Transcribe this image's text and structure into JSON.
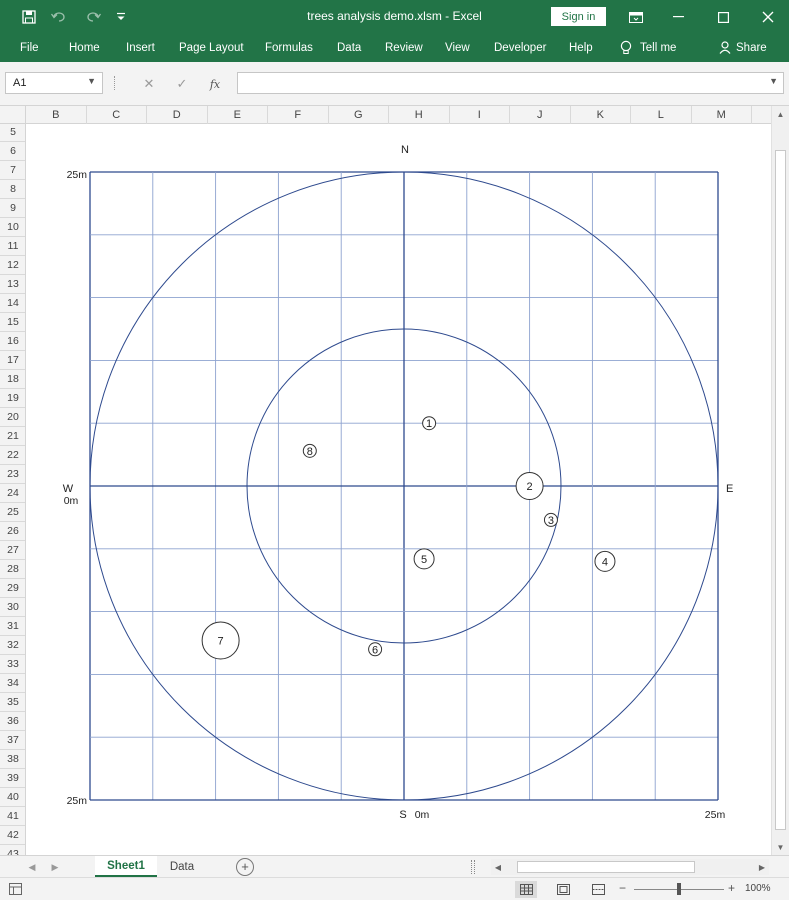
{
  "title_bar": {
    "title": "trees analysis demo.xlsm  -  Excel",
    "sign_in_label": "Sign in",
    "save_icon": "save-icon",
    "undo_icon": "undo-icon",
    "redo_icon": "redo-icon",
    "customize_icon": "customize-quick-access-icon",
    "window_controls": [
      "ribbon-display-options-icon",
      "minimize-icon",
      "maximize-icon",
      "close-icon"
    ]
  },
  "ribbon": {
    "tabs": [
      {
        "label": "File"
      },
      {
        "label": "Home"
      },
      {
        "label": "Insert"
      },
      {
        "label": "Page Layout"
      },
      {
        "label": "Formulas"
      },
      {
        "label": "Data"
      },
      {
        "label": "Review"
      },
      {
        "label": "View"
      },
      {
        "label": "Developer"
      },
      {
        "label": "Help"
      }
    ],
    "tell_me": "Tell me",
    "share": "Share"
  },
  "formula_bar": {
    "name_box": "A1",
    "formula": "",
    "cancel_icon": "cancel-icon",
    "enter_icon": "enter-icon",
    "fx_icon": "fx-icon"
  },
  "columns": [
    "B",
    "C",
    "D",
    "E",
    "F",
    "G",
    "H",
    "I",
    "J",
    "K",
    "L",
    "M"
  ],
  "rows": [
    "5",
    "6",
    "7",
    "8",
    "9",
    "10",
    "11",
    "12",
    "13",
    "14",
    "15",
    "16",
    "17",
    "18",
    "19",
    "20",
    "21",
    "22",
    "23",
    "24",
    "25",
    "26",
    "27",
    "28",
    "29",
    "30",
    "31",
    "32",
    "33",
    "34",
    "35",
    "36",
    "37",
    "38",
    "39",
    "40",
    "41",
    "42",
    "43"
  ],
  "plot": {
    "labels": {
      "north": "N",
      "south": "S",
      "west": "W",
      "east": "E",
      "top_left": "25m",
      "west_zero": "0m",
      "bottom_left": "25m",
      "bottom_zero": "0m",
      "bottom_right": "25m"
    },
    "trees": [
      {
        "label": "1",
        "x": 2,
        "y": 5,
        "size": "small"
      },
      {
        "label": "2",
        "x": 10,
        "y": 0,
        "size": "large"
      },
      {
        "label": "3",
        "x": 11.7,
        "y": -2.7,
        "size": "small"
      },
      {
        "label": "4",
        "x": 16,
        "y": -6,
        "size": "medium"
      },
      {
        "label": "5",
        "x": 1.6,
        "y": -5.8,
        "size": "medium"
      },
      {
        "label": "6",
        "x": -2.3,
        "y": -13,
        "size": "small"
      },
      {
        "label": "7",
        "x": -14.6,
        "y": -12.3,
        "size": "xlarge"
      },
      {
        "label": "8",
        "x": -7.5,
        "y": 2.8,
        "size": "small"
      }
    ]
  },
  "sheet_tabs": [
    {
      "label": "Sheet1",
      "active": true
    },
    {
      "label": "Data",
      "active": false
    }
  ],
  "status_bar": {
    "zoom": "100%",
    "zoom_fraction": 0.5
  }
}
